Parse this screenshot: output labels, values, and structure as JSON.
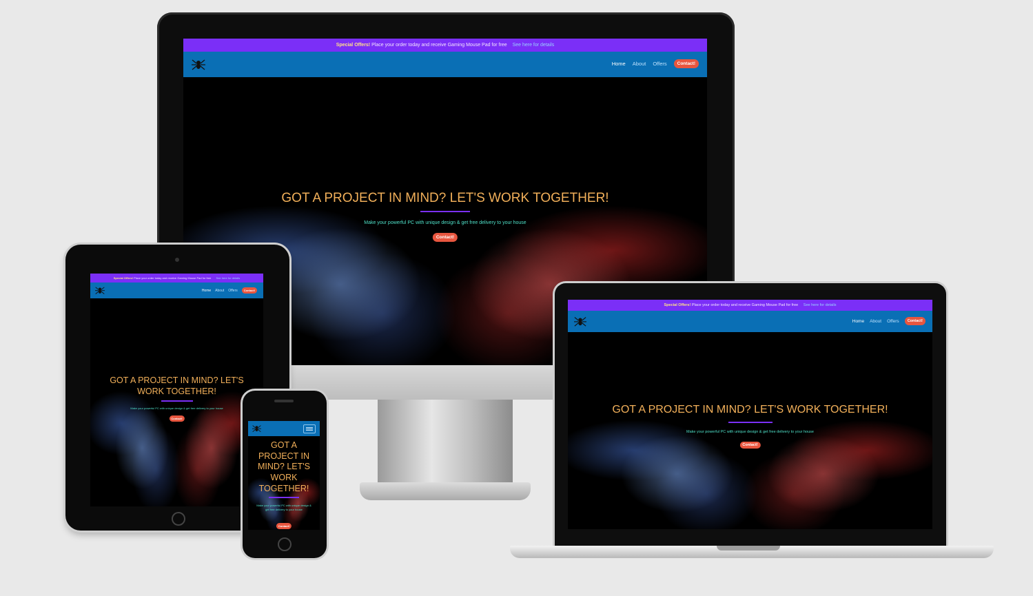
{
  "site": {
    "promo_bold": "Special Offers!",
    "promo_text": "Place your order today and receive Gaming Mouse Pad for free",
    "promo_link": "See here for details",
    "nav": [
      "Home",
      "About",
      "Offers"
    ],
    "contact_button": "Contact!",
    "hero_title": "GOT A PROJECT IN MIND? LET'S WORK TOGETHER!",
    "hero_subtitle": "Make your powerful PC with unique design & get free delivery to your house",
    "hero_button": "Contact!",
    "menu_icon": "hamburger-icon",
    "logo_icon": "spider-logo-icon"
  },
  "phone_hero_title": "GOT A PROJECT IN MIND? LET'S WORK TOGETHER!",
  "colors": {
    "promo_bar": "#7b2ff7",
    "navbar": "#0a6fb5",
    "button": "#e8563f",
    "title": "#f2b05a",
    "subtitle": "#4fe0c8",
    "background": "#e9e9e9"
  }
}
